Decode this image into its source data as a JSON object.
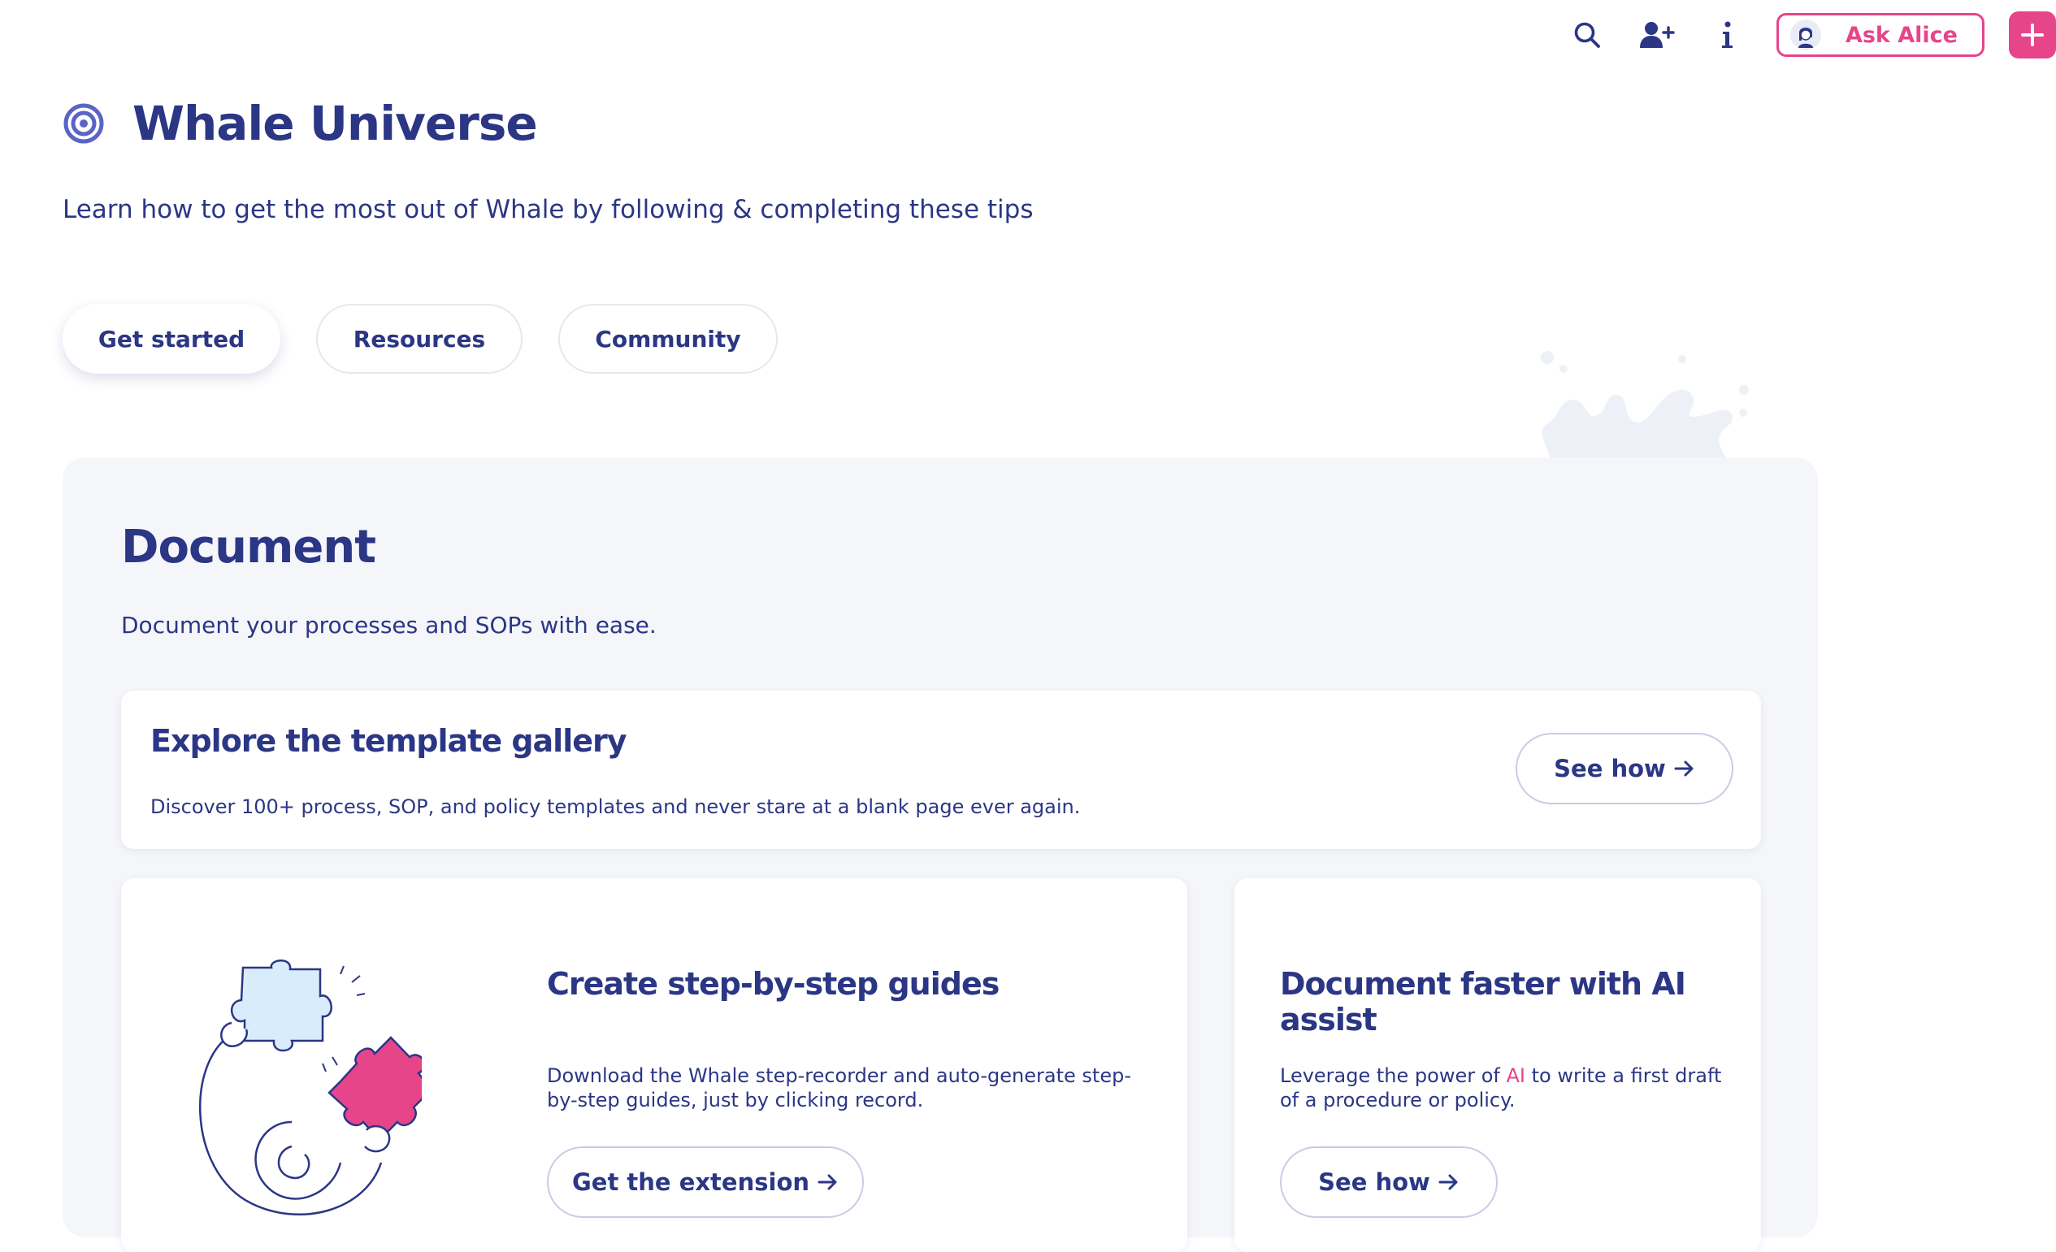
{
  "topbar": {
    "icons": [
      "search-icon",
      "add-user-icon",
      "info-icon"
    ],
    "ask_label": "Ask Alice",
    "colors": {
      "accent": "#e6458a",
      "primary": "#2b3685"
    }
  },
  "header": {
    "title": "Whale Universe",
    "subtitle": "Learn how to get the most out of Whale by following & completing these tips"
  },
  "tabs": [
    {
      "label": "Get started",
      "active": true
    },
    {
      "label": "Resources",
      "active": false
    },
    {
      "label": "Community",
      "active": false
    }
  ],
  "section": {
    "title": "Document",
    "description": "Document your processes and SOPs with ease.",
    "cards": {
      "template_gallery": {
        "title": "Explore the template gallery",
        "description": "Discover 100+ process, SOP, and policy templates and never stare at a blank page ever again.",
        "button": "See how"
      },
      "step_guides": {
        "title": "Create step-by-step guides",
        "description_line1": "Download the Whale step-recorder and auto-generate step-",
        "description_line2": "by-step guides, just by clicking record.",
        "button": "Get the extension"
      },
      "ai_assist": {
        "title": "Document faster with AI assist",
        "description_pre": "Leverage the power of ",
        "description_highlight": "AI",
        "description_post": " to write a first draft",
        "description_line2": "of a procedure or policy.",
        "button": "See how"
      }
    }
  }
}
